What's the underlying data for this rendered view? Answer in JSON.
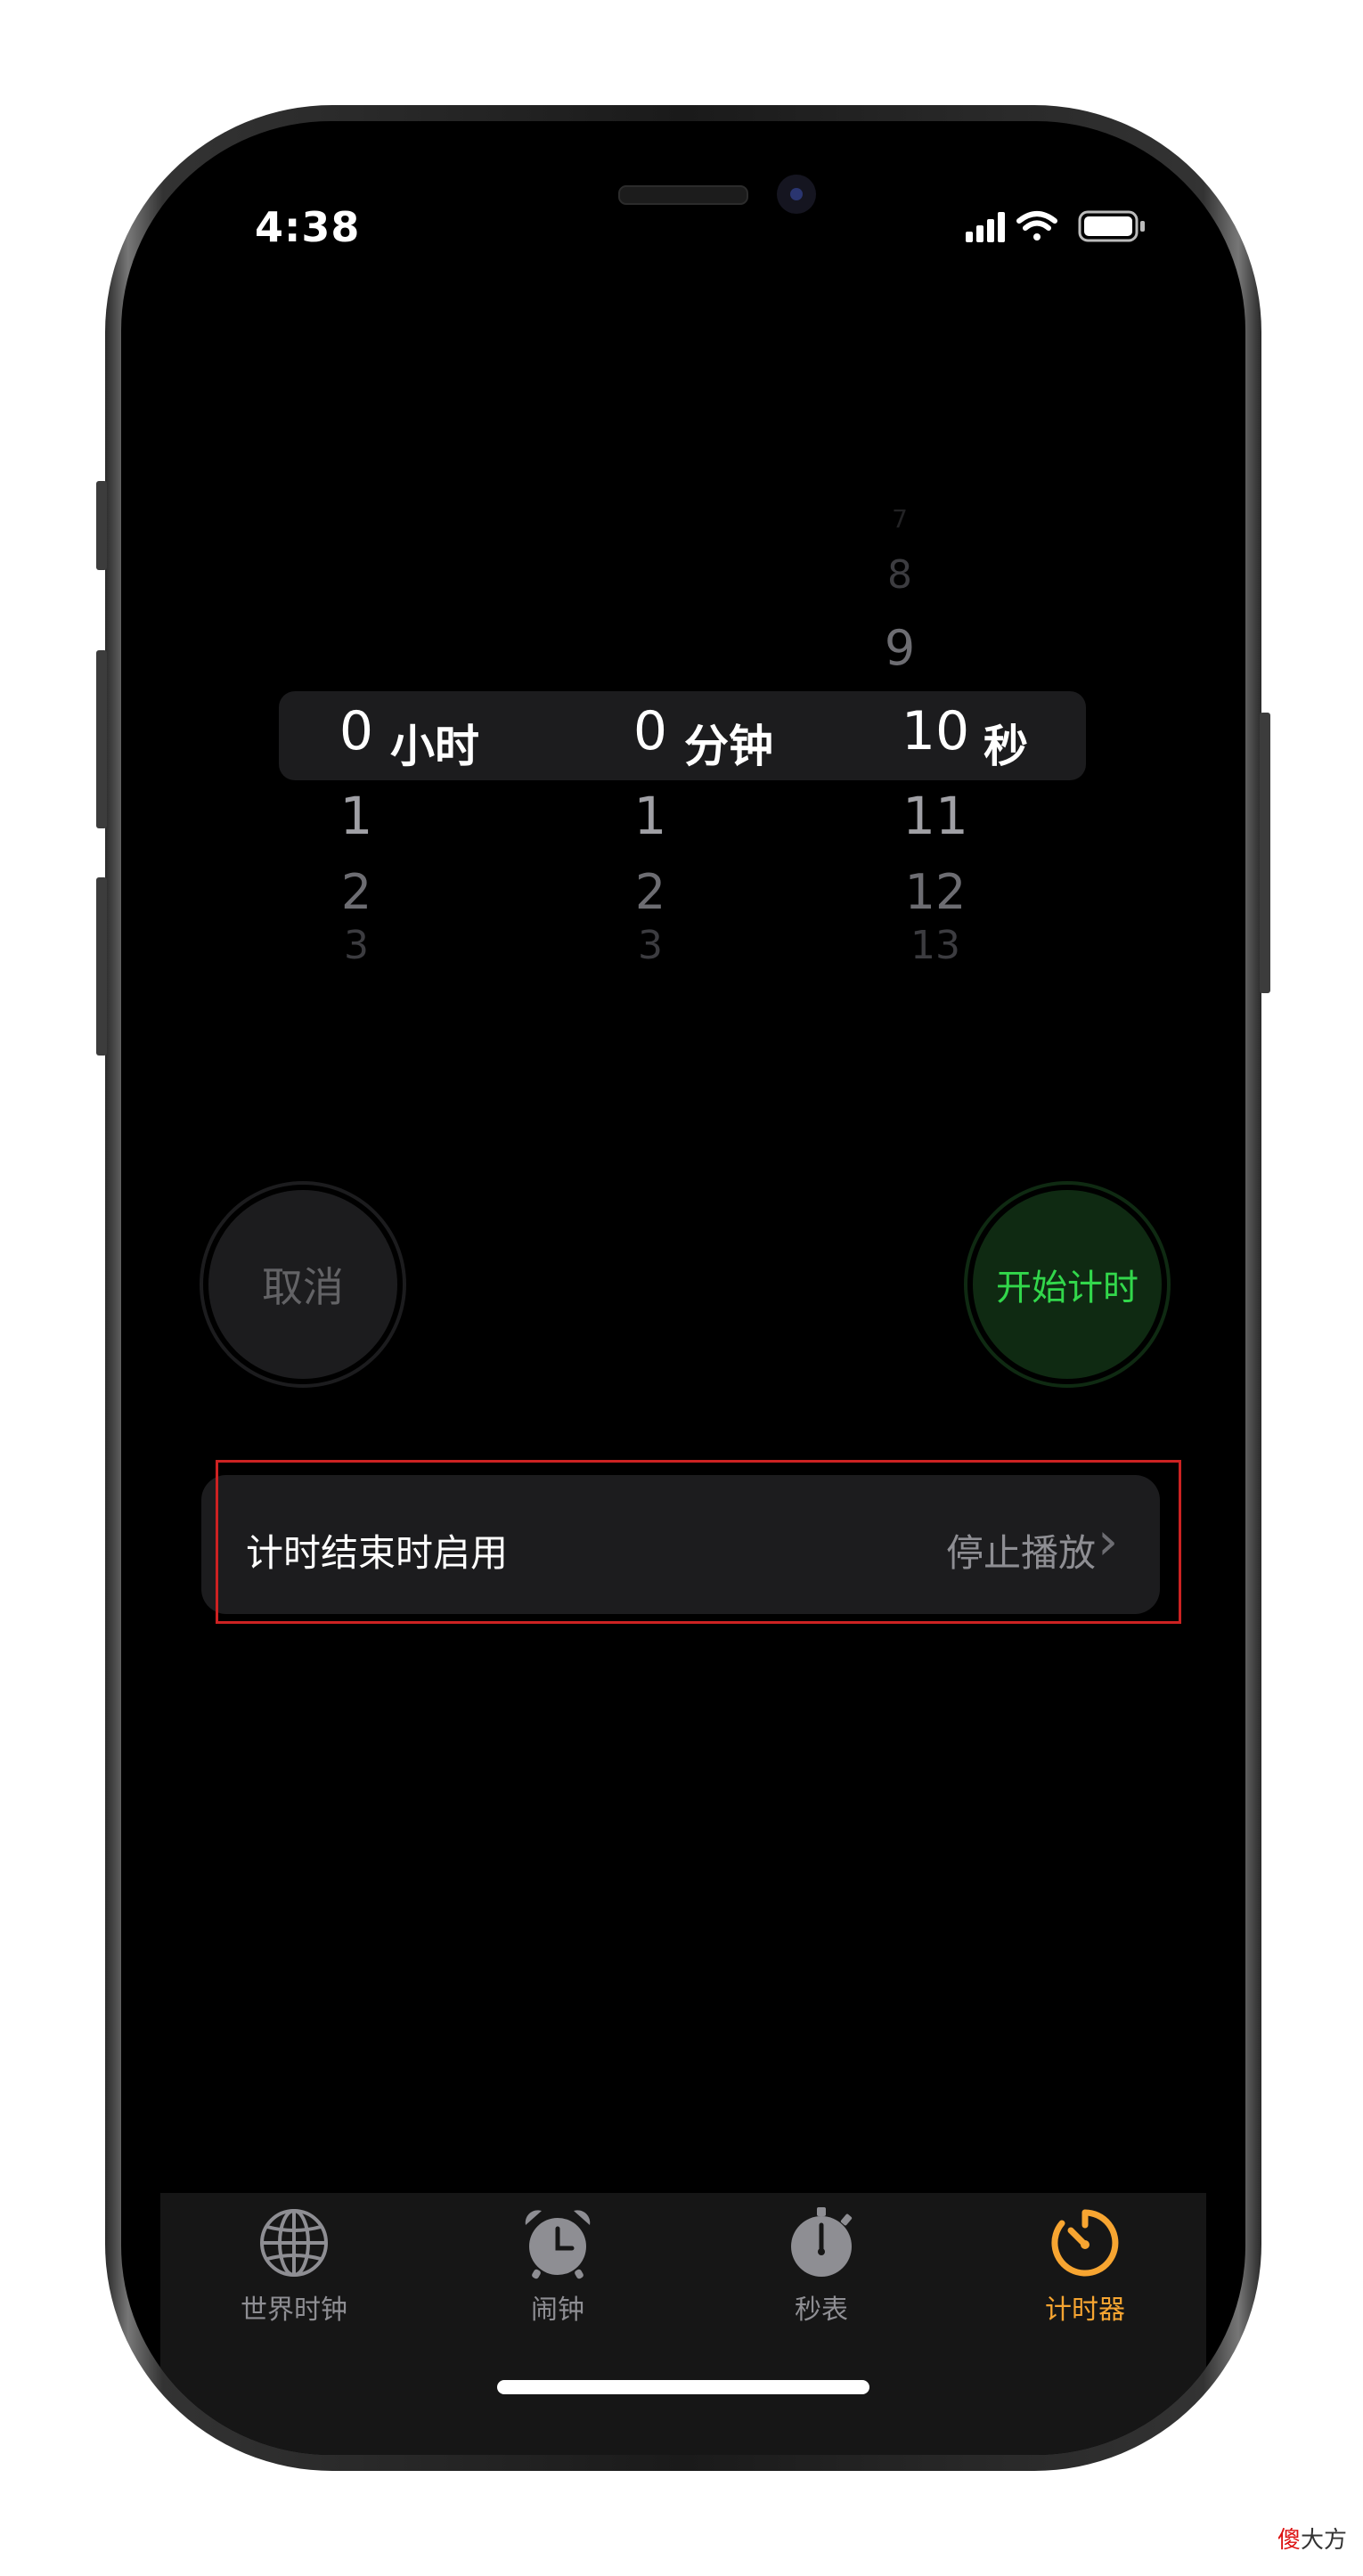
{
  "status_bar": {
    "time": "4:38"
  },
  "picker": {
    "hours": {
      "above": [],
      "selected": "0",
      "unit": "小时",
      "below": [
        "1",
        "2",
        "3"
      ]
    },
    "minutes": {
      "above": [],
      "selected": "0",
      "unit": "分钟",
      "below": [
        "1",
        "2",
        "3"
      ]
    },
    "seconds": {
      "above": [
        "7",
        "8",
        "9"
      ],
      "selected": "10",
      "unit": "秒",
      "below": [
        "11",
        "12",
        "13"
      ]
    }
  },
  "buttons": {
    "cancel": "取消",
    "start": "开始计时"
  },
  "settings_row": {
    "label": "计时结束时启用",
    "value": "停止播放",
    "chevron": "›"
  },
  "tabs": [
    {
      "label": "世界时钟",
      "icon": "globe-icon",
      "active": false
    },
    {
      "label": "闹钟",
      "icon": "alarm-icon",
      "active": false
    },
    {
      "label": "秒表",
      "icon": "stopwatch-icon",
      "active": false
    },
    {
      "label": "计时器",
      "icon": "timer-icon",
      "active": true
    }
  ],
  "colors": {
    "accent_active_tab": "#f7a531",
    "start_green": "#32d74b",
    "highlight_red": "#cc2222"
  },
  "watermark": {
    "prefix": "傻",
    "text": "大方"
  }
}
